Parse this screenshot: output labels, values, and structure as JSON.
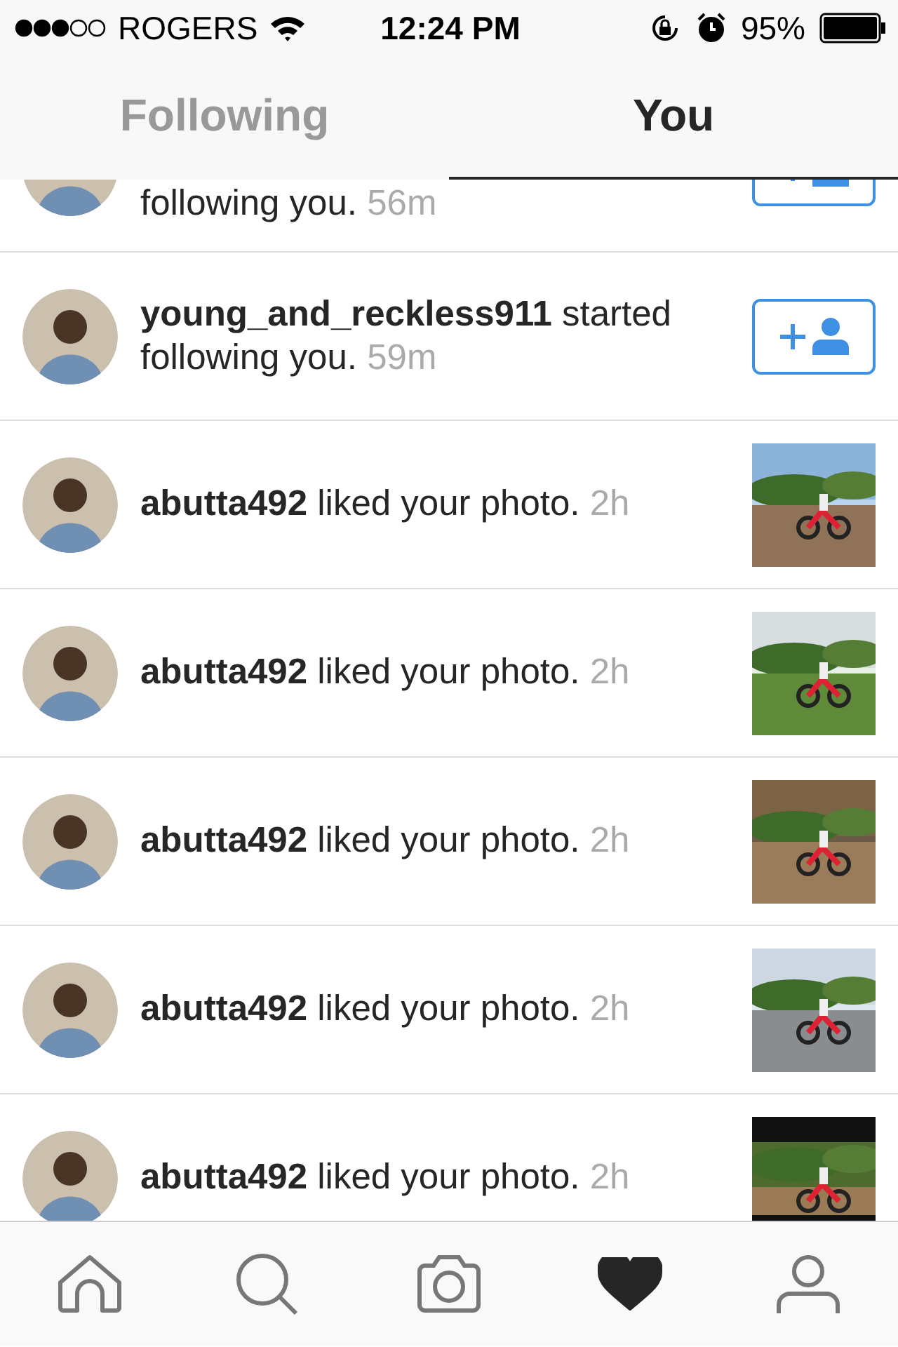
{
  "status_bar": {
    "carrier": "ROGERS",
    "time": "12:24 PM",
    "battery": "95%"
  },
  "tabs": [
    {
      "label": "Following",
      "selected": false
    },
    {
      "label": "You",
      "selected": true
    }
  ],
  "activity": [
    {
      "kind": "follow",
      "text": "following you.",
      "time": "56m"
    },
    {
      "kind": "follow",
      "text": "**young_and_reckless911** started following you.",
      "time": "59m"
    },
    {
      "kind": "like",
      "text": "**abutta492** liked your photo.",
      "time": "2h"
    },
    {
      "kind": "like",
      "text": "**abutta492** liked your photo.",
      "time": "2h"
    },
    {
      "kind": "like",
      "text": "**abutta492** liked your photo.",
      "time": "2h"
    },
    {
      "kind": "like",
      "text": "**abutta492** liked your photo.",
      "time": "2h"
    },
    {
      "kind": "like",
      "text": "**abutta492** liked your photo.",
      "time": "2h"
    }
  ],
  "nav": [
    {
      "kind": "home",
      "selected": false
    },
    {
      "kind": "search",
      "selected": false
    },
    {
      "kind": "camera",
      "selected": false
    },
    {
      "kind": "heart",
      "selected": true
    },
    {
      "kind": "profile",
      "selected": false
    }
  ]
}
